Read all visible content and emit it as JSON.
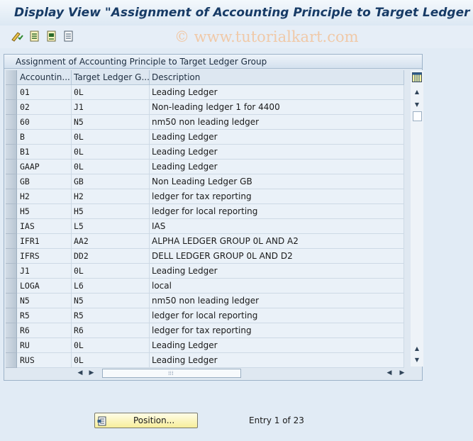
{
  "window": {
    "title": "Display View \"Assignment of Accounting Principle to Target Ledger Grou"
  },
  "toolbar": {
    "buttons": [
      {
        "name": "other-view-icon"
      },
      {
        "name": "select-all-icon"
      },
      {
        "name": "select-block-icon"
      },
      {
        "name": "deselect-all-icon"
      }
    ]
  },
  "watermark": "© www.tutorialkart.com",
  "table": {
    "title": "Assignment of Accounting Principle to Target Ledger Group",
    "columns": [
      "Accountin...",
      "Target Ledger G...",
      "Description"
    ],
    "rows": [
      {
        "principle": "01",
        "ledger_group": "0L",
        "description": "Leading Ledger"
      },
      {
        "principle": "02",
        "ledger_group": "J1",
        "description": "Non-leading ledger 1 for 4400"
      },
      {
        "principle": "60",
        "ledger_group": "N5",
        "description": "nm50 non leading ledger"
      },
      {
        "principle": "B",
        "ledger_group": "0L",
        "description": "Leading Ledger"
      },
      {
        "principle": "B1",
        "ledger_group": "0L",
        "description": "Leading Ledger"
      },
      {
        "principle": "GAAP",
        "ledger_group": "0L",
        "description": "Leading Ledger"
      },
      {
        "principle": "GB",
        "ledger_group": "GB",
        "description": "Non Leading Ledger GB"
      },
      {
        "principle": "H2",
        "ledger_group": "H2",
        "description": "ledger for tax reporting"
      },
      {
        "principle": "H5",
        "ledger_group": "H5",
        "description": "ledger for local reporting"
      },
      {
        "principle": "IAS",
        "ledger_group": "L5",
        "description": "IAS"
      },
      {
        "principle": "IFR1",
        "ledger_group": "AA2",
        "description": "ALPHA LEDGER GROUP 0L AND A2"
      },
      {
        "principle": "IFRS",
        "ledger_group": "DD2",
        "description": "DELL LEDGER GROUP 0L AND D2"
      },
      {
        "principle": "J1",
        "ledger_group": "0L",
        "description": "Leading Ledger"
      },
      {
        "principle": "LOGA",
        "ledger_group": "L6",
        "description": "local"
      },
      {
        "principle": "N5",
        "ledger_group": "N5",
        "description": "nm50 non leading ledger"
      },
      {
        "principle": "R5",
        "ledger_group": "R5",
        "description": "ledger for local reporting"
      },
      {
        "principle": "R6",
        "ledger_group": "R6",
        "description": "ledger for tax reporting"
      },
      {
        "principle": "RU",
        "ledger_group": "0L",
        "description": "Leading Ledger"
      },
      {
        "principle": "RUS",
        "ledger_group": "0L",
        "description": "Leading Ledger"
      }
    ]
  },
  "footer": {
    "position_button_label": "Position...",
    "entry_text": "Entry 1 of 23"
  },
  "colors": {
    "background": "#e1ebf5",
    "title_text": "#173b66",
    "button_yellow": "#f7ee9a"
  }
}
